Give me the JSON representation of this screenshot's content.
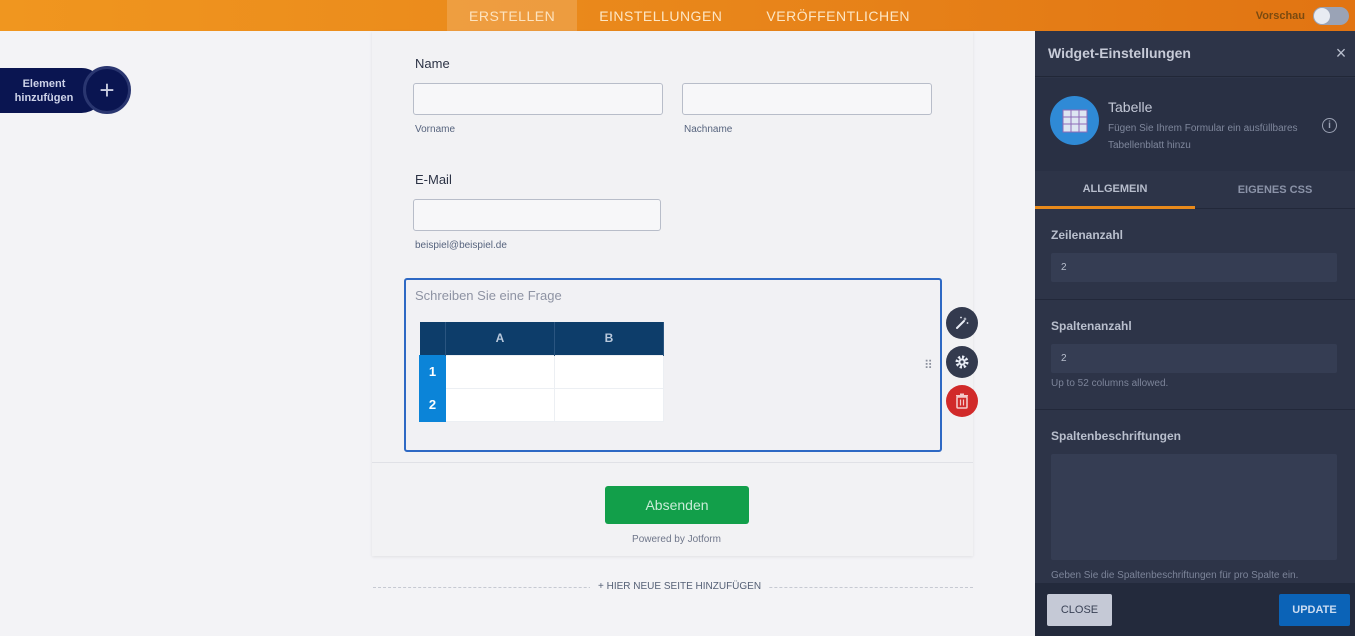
{
  "topbar": {
    "tabs": [
      "ERSTELLEN",
      "EINSTELLUNGEN",
      "VERÖFFENTLICHEN"
    ],
    "preview_label": "Vorschau",
    "preview_on": false
  },
  "add_element": {
    "line1": "Element",
    "line2": "hinzufügen"
  },
  "form": {
    "name_label": "Name",
    "first_sublabel": "Vorname",
    "last_sublabel": "Nachname",
    "email_label": "E-Mail",
    "email_sublabel": "beispiel@beispiel.de",
    "question_placeholder": "Schreiben Sie eine Frage",
    "table": {
      "columns": [
        "A",
        "B"
      ],
      "rows": [
        "1",
        "2"
      ]
    },
    "submit_label": "Absenden",
    "powered_by": "Powered by Jotform",
    "add_page": "+ HIER NEUE SEITE HINZUFÜGEN"
  },
  "panel": {
    "title": "Widget-Einstellungen",
    "widget_name": "Tabelle",
    "widget_desc": "Fügen Sie Ihrem Formular ein ausfüllbares Tabellenblatt hinzu",
    "tabs": [
      "ALLGEMEIN",
      "EIGENES CSS"
    ],
    "rows_label": "Zeilenanzahl",
    "rows_value": "2",
    "cols_label": "Spaltenanzahl",
    "cols_value": "2",
    "cols_help": "Up to 52 columns allowed.",
    "col_labels_label": "Spaltenbeschriftungen",
    "col_labels_help": "Geben Sie die Spaltenbeschriftungen für pro Spalte ein.",
    "close_btn": "CLOSE",
    "update_btn": "UPDATE"
  },
  "colors": {
    "accent_orange": "#e8851a",
    "panel_bg": "#2d3448",
    "submit_green": "#129f4a",
    "focus_blue": "#2e69c4"
  }
}
